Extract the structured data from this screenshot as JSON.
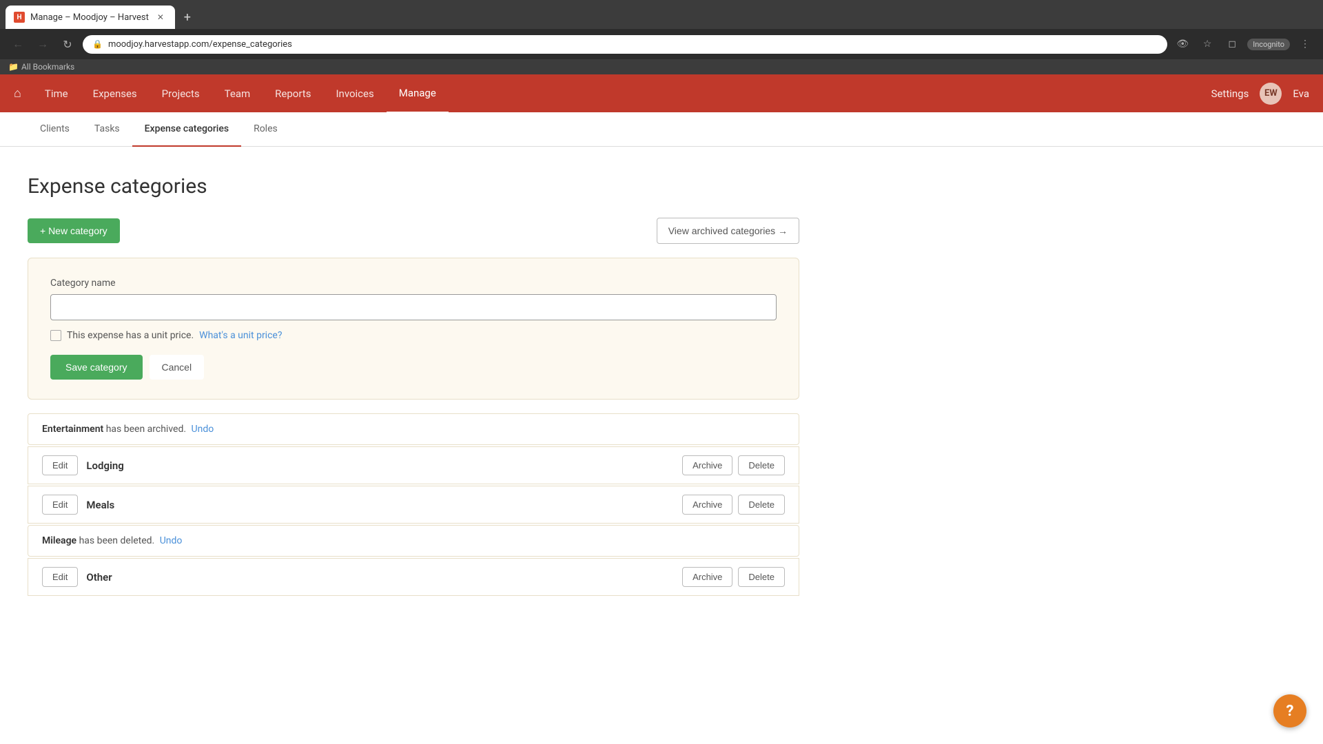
{
  "browser": {
    "tab_title": "Manage – Moodjoy – Harvest",
    "favicon_text": "H",
    "url": "moodjoy.harvestapp.com/expense_categories",
    "incognito_label": "Incognito",
    "bookmarks_label": "All Bookmarks"
  },
  "nav": {
    "home_icon": "⌂",
    "items": [
      {
        "label": "Time",
        "active": false
      },
      {
        "label": "Expenses",
        "active": false
      },
      {
        "label": "Projects",
        "active": false
      },
      {
        "label": "Team",
        "active": false
      },
      {
        "label": "Reports",
        "active": false
      },
      {
        "label": "Invoices",
        "active": false
      },
      {
        "label": "Manage",
        "active": true
      }
    ],
    "settings_label": "Settings",
    "user_initials": "EW",
    "user_name": "Eva"
  },
  "sub_nav": {
    "items": [
      {
        "label": "Clients",
        "active": false
      },
      {
        "label": "Tasks",
        "active": false
      },
      {
        "label": "Expense categories",
        "active": true
      },
      {
        "label": "Roles",
        "active": false
      }
    ]
  },
  "page": {
    "title": "Expense categories",
    "new_category_btn": "+ New category",
    "view_archived_btn": "View archived categories →"
  },
  "form": {
    "category_name_label": "Category name",
    "category_name_placeholder": "",
    "unit_price_text": "This expense has a unit price.",
    "unit_price_link": "What's a unit price?",
    "save_btn": "Save category",
    "cancel_btn": "Cancel"
  },
  "notifications": [
    {
      "type": "archived",
      "item_name": "Entertainment",
      "message": " has been archived.",
      "undo_label": "Undo"
    },
    {
      "type": "deleted",
      "item_name": "Mileage",
      "message": " has been deleted.",
      "undo_label": "Undo"
    }
  ],
  "categories": [
    {
      "name": "Lodging"
    },
    {
      "name": "Meals"
    },
    {
      "name": "Other"
    }
  ],
  "category_row_labels": {
    "edit": "Edit",
    "archive": "Archive",
    "delete": "Delete"
  },
  "help_btn": "?"
}
